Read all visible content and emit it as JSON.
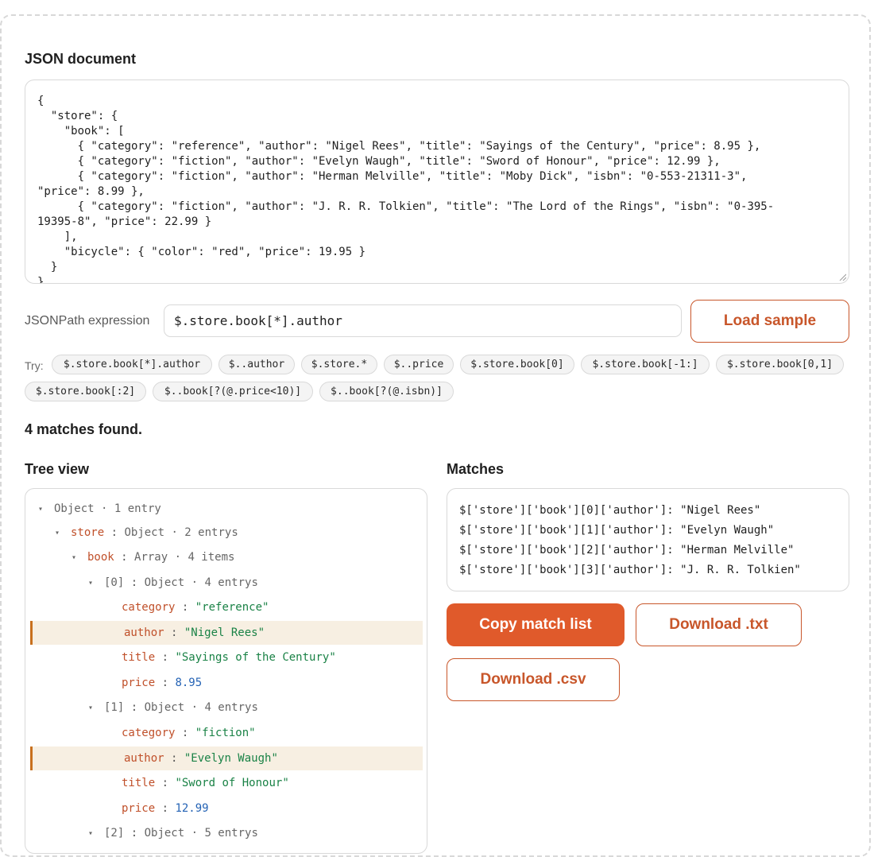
{
  "editor": {
    "heading": "JSON document",
    "lines": [
      "{",
      "  \"store\": {",
      "    \"book\": [",
      "      { \"category\": \"reference\", \"author\": \"Nigel Rees\", \"title\": \"Sayings of the Century\", \"price\": 8.95 },",
      "      { \"category\": \"fiction\", \"author\": \"Evelyn Waugh\", \"title\": \"Sword of Honour\", \"price\": 12.99 },",
      "      { \"category\": \"fiction\", \"author\": \"Herman Melville\", \"title\": \"Moby Dick\", \"isbn\": \"0-553-21311-3\",",
      "\"price\": 8.99 },",
      "      { \"category\": \"fiction\", \"author\": \"J. R. R. Tolkien\", \"title\": \"The Lord of the Rings\", \"isbn\": \"0-395-",
      "19395-8\", \"price\": 22.99 }",
      "    ],",
      "    \"bicycle\": { \"color\": \"red\", \"price\": 19.95 }",
      "  }",
      "}"
    ]
  },
  "expression": {
    "label": "JSONPath expression",
    "value": "$.store.book[*].author",
    "load_sample": "Load sample"
  },
  "try": {
    "label": "Try:",
    "chips": [
      "$.store.book[*].author",
      "$..author",
      "$.store.*",
      "$..price",
      "$.store.book[0]",
      "$.store.book[-1:]",
      "$.store.book[0,1]",
      "$.store.book[:2]",
      "$..book[?(@.price<10)]",
      "$..book[?(@.isbn)]"
    ]
  },
  "status": "4 matches found.",
  "tree": {
    "heading": "Tree view",
    "rows": [
      {
        "key": "",
        "type": "Object · 1 entry"
      },
      {
        "key": "store",
        "type": "Object · 2 entrys"
      },
      {
        "key": "book",
        "type": "Array · 4 items"
      },
      {
        "key": "[0]",
        "type": "Object · 4 entrys"
      },
      {
        "key": "category",
        "value": "\"reference\""
      },
      {
        "key": "author",
        "value": "\"Nigel Rees\""
      },
      {
        "key": "title",
        "value": "\"Sayings of the Century\""
      },
      {
        "key": "price",
        "value": "8.95"
      },
      {
        "key": "[1]",
        "type": "Object · 4 entrys"
      },
      {
        "key": "category",
        "value": "\"fiction\""
      },
      {
        "key": "author",
        "value": "\"Evelyn Waugh\""
      },
      {
        "key": "title",
        "value": "\"Sword of Honour\""
      },
      {
        "key": "price",
        "value": "12.99"
      },
      {
        "key": "[2]",
        "type": "Object · 5 entrys"
      }
    ]
  },
  "matches": {
    "heading": "Matches",
    "lines": [
      "$['store']['book'][0]['author']: \"Nigel Rees\"",
      "$['store']['book'][1]['author']: \"Evelyn Waugh\"",
      "$['store']['book'][2]['author']: \"Herman Melville\"",
      "$['store']['book'][3]['author']: \"J. R. R. Tolkien\""
    ],
    "copy_label": "Copy match list",
    "txt_label": "Download .txt",
    "csv_label": "Download .csv"
  },
  "colors": {
    "accent": "#e05a2b",
    "key": "#c0502a",
    "string": "#1a8246",
    "number": "#2563b5",
    "highlight": "#f7efe2"
  }
}
